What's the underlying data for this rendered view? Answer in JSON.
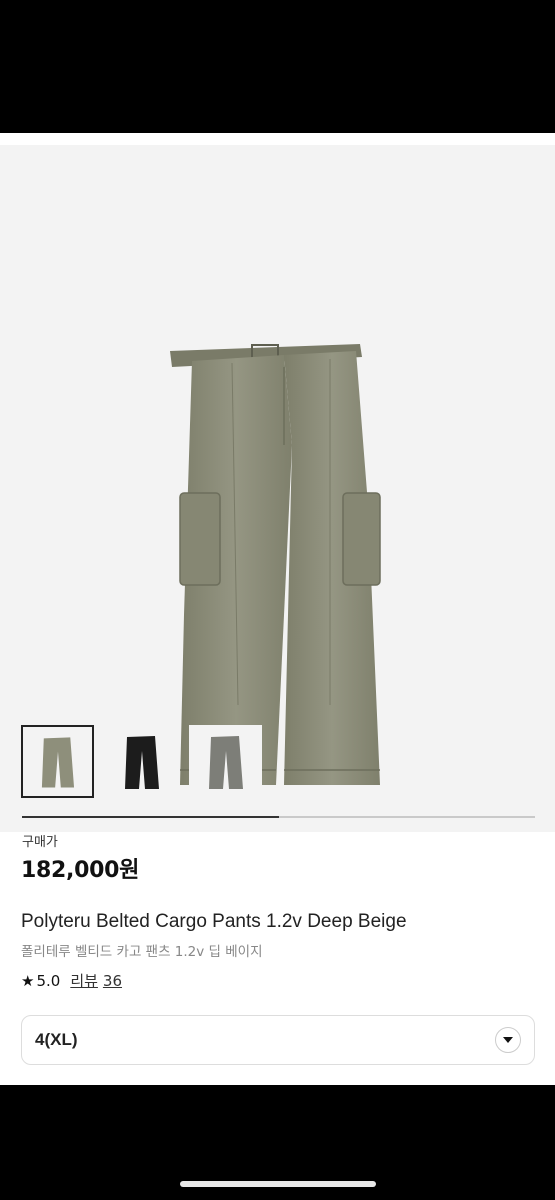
{
  "gallery": {
    "slide_progress": 0.5,
    "thumbnails": [
      {
        "name": "deep-beige",
        "color": "#8e8f7b",
        "selected": true
      },
      {
        "name": "black",
        "color": "#1c1c1c",
        "selected": false
      },
      {
        "name": "gray",
        "color": "#7d7e78",
        "selected": false
      }
    ]
  },
  "price": {
    "label": "구매가",
    "value": "182,000원"
  },
  "product": {
    "title_en": "Polyteru Belted Cargo Pants 1.2v Deep Beige",
    "title_ko": "폴리테루 벨티드 카고 팬츠 1.2v 딥 베이지"
  },
  "rating": {
    "score": "5.0",
    "reviews_label": "리뷰",
    "reviews_count": "36"
  },
  "option": {
    "selected": "4(XL)"
  }
}
